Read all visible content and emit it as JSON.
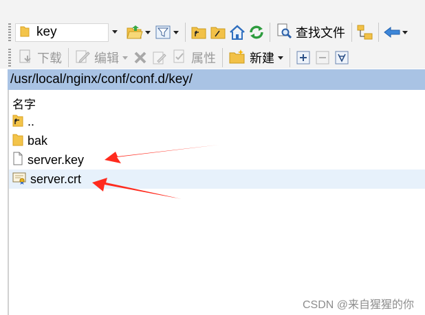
{
  "toolbar": {
    "location_combo": "key",
    "find_files_label": "查找文件",
    "download_label": "下载",
    "edit_label": "编辑",
    "properties_label": "属性",
    "new_label": "新建"
  },
  "path_bar": {
    "path": "/usr/local/nginx/conf/conf.d/key/"
  },
  "file_list": {
    "column_header": "名字",
    "items": [
      {
        "name": "..",
        "icon": "parent-folder-icon",
        "selected": false
      },
      {
        "name": "bak",
        "icon": "folder-icon",
        "selected": false
      },
      {
        "name": "server.key",
        "icon": "file-icon",
        "selected": false
      },
      {
        "name": "server.crt",
        "icon": "certificate-icon",
        "selected": true
      }
    ]
  },
  "watermark": "CSDN @来自猩猩的你",
  "colors": {
    "path_bar_bg": "#a9c3e4",
    "selected_row_bg": "#e7f1fb",
    "annotation_arrow": "#ff2b1e"
  }
}
